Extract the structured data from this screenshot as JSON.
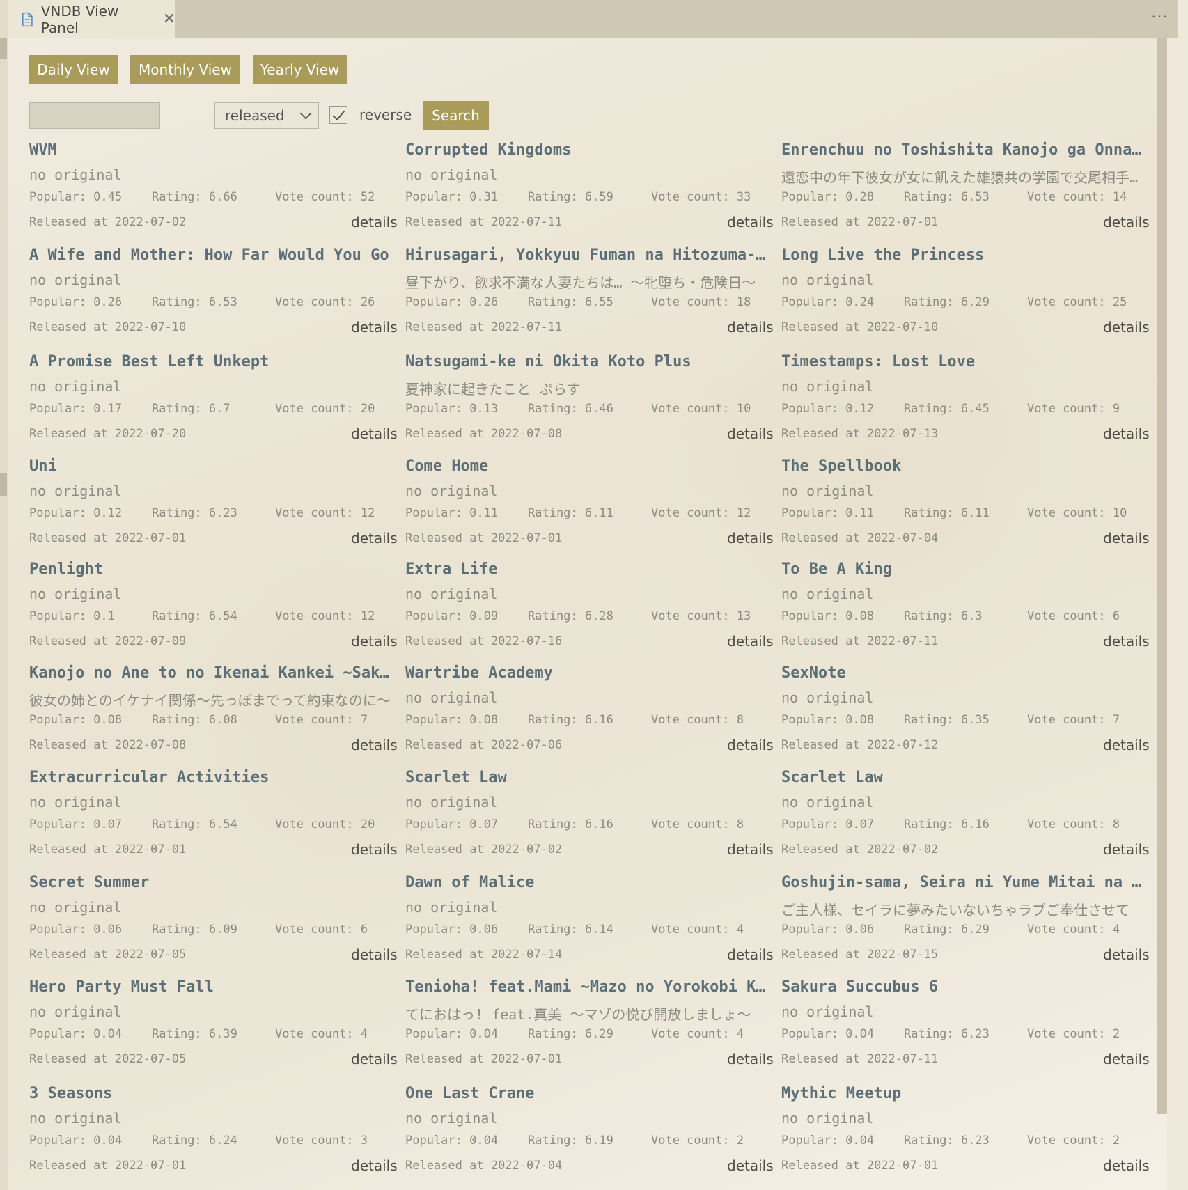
{
  "tab": {
    "title": "VNDB View Panel",
    "close": "✕",
    "more": "···"
  },
  "views": [
    "Daily View",
    "Monthly View",
    "Yearly View"
  ],
  "search": {
    "value": "",
    "placeholder": "",
    "sort": "released",
    "reverse_label": "reverse",
    "reverse_checked": true,
    "button": "Search"
  },
  "details_label": "details",
  "items": [
    {
      "title": "WVM",
      "original": "no original",
      "popular": "0.45",
      "rating": "6.66",
      "votes": "52",
      "released": "2022-07-02"
    },
    {
      "title": "Corrupted Kingdoms",
      "original": "no original",
      "popular": "0.31",
      "rating": "6.59",
      "votes": "33",
      "released": "2022-07-11"
    },
    {
      "title": "Enrenchuu no Toshishita Kanojo ga Onna ni Ueta Yuuzaru-domo no Gakuen de Koubi",
      "original": "遠恋中の年下彼女が女に飢えた雄猿共の学園で交尾相手にされる話",
      "popular": "0.28",
      "rating": "6.53",
      "votes": "14",
      "released": "2022-07-01"
    },
    {
      "title": "A Wife and Mother: How Far Would You Go",
      "original": "no original",
      "popular": "0.26",
      "rating": "6.53",
      "votes": "26",
      "released": "2022-07-10"
    },
    {
      "title": "Hirusagari, Yokkyuu Fuman na Hitozuma-tachi wa",
      "original": "昼下がり、欲求不満な人妻たちは… 〜牝堕ち・危険日〜",
      "popular": "0.26",
      "rating": "6.55",
      "votes": "18",
      "released": "2022-07-11"
    },
    {
      "title": "Long Live the Princess",
      "original": "no original",
      "popular": "0.24",
      "rating": "6.29",
      "votes": "25",
      "released": "2022-07-10"
    },
    {
      "title": "A Promise Best Left Unkept",
      "original": "no original",
      "popular": "0.17",
      "rating": "6.7",
      "votes": "20",
      "released": "2022-07-20"
    },
    {
      "title": "Natsugami-ke ni Okita Koto Plus",
      "original": "夏神家に起きたこと ぷらす",
      "popular": "0.13",
      "rating": "6.46",
      "votes": "10",
      "released": "2022-07-08"
    },
    {
      "title": "Timestamps: Lost Love",
      "original": "no original",
      "popular": "0.12",
      "rating": "6.45",
      "votes": "9",
      "released": "2022-07-13"
    },
    {
      "title": "Uni",
      "original": "no original",
      "popular": "0.12",
      "rating": "6.23",
      "votes": "12",
      "released": "2022-07-01"
    },
    {
      "title": "Come Home",
      "original": "no original",
      "popular": "0.11",
      "rating": "6.11",
      "votes": "12",
      "released": "2022-07-01"
    },
    {
      "title": "The Spellbook",
      "original": "no original",
      "popular": "0.11",
      "rating": "6.11",
      "votes": "10",
      "released": "2022-07-04"
    },
    {
      "title": "Penlight",
      "original": "no original",
      "popular": "0.1",
      "rating": "6.54",
      "votes": "12",
      "released": "2022-07-09"
    },
    {
      "title": "Extra Life",
      "original": "no original",
      "popular": "0.09",
      "rating": "6.28",
      "votes": "13",
      "released": "2022-07-16"
    },
    {
      "title": "To Be A King",
      "original": "no original",
      "popular": "0.08",
      "rating": "6.3",
      "votes": "6",
      "released": "2022-07-11"
    },
    {
      "title": "Kanojo no Ane to no Ikenai Kankei ~Sakippo made tte Yakusoku na no ni",
      "original": "彼女の姉とのイケナイ関係〜先っぽまでって約束なのに〜",
      "popular": "0.08",
      "rating": "6.08",
      "votes": "7",
      "released": "2022-07-08"
    },
    {
      "title": "Wartribe Academy",
      "original": "no original",
      "popular": "0.08",
      "rating": "6.16",
      "votes": "8",
      "released": "2022-07-06"
    },
    {
      "title": "SexNote",
      "original": "no original",
      "popular": "0.08",
      "rating": "6.35",
      "votes": "7",
      "released": "2022-07-12"
    },
    {
      "title": "Extracurricular Activities",
      "original": "no original",
      "popular": "0.07",
      "rating": "6.54",
      "votes": "20",
      "released": "2022-07-01"
    },
    {
      "title": "Scarlet Law",
      "original": "no original",
      "popular": "0.07",
      "rating": "6.16",
      "votes": "8",
      "released": "2022-07-02"
    },
    {
      "title": "Scarlet Law",
      "original": "no original",
      "popular": "0.07",
      "rating": "6.16",
      "votes": "8",
      "released": "2022-07-02"
    },
    {
      "title": "Secret Summer",
      "original": "no original",
      "popular": "0.06",
      "rating": "6.09",
      "votes": "6",
      "released": "2022-07-05"
    },
    {
      "title": "Dawn of Malice",
      "original": "no original",
      "popular": "0.06",
      "rating": "6.14",
      "votes": "4",
      "released": "2022-07-14"
    },
    {
      "title": "Goshujin-sama, Seira ni Yume Mitai na Icha Love Gohoushi sasete",
      "original": "ご主人様、セイラに夢みたいないちゃラブご奉仕させて",
      "popular": "0.06",
      "rating": "6.29",
      "votes": "4",
      "released": "2022-07-15"
    },
    {
      "title": "Hero Party Must Fall",
      "original": "no original",
      "popular": "0.04",
      "rating": "6.39",
      "votes": "4",
      "released": "2022-07-05"
    },
    {
      "title": "Tenioha! feat.Mami ~Mazo no Yorokobi Kaihou shimasho",
      "original": "てにおはっ! feat.真美 〜マゾの悦び開放しましょ〜",
      "popular": "0.04",
      "rating": "6.29",
      "votes": "4",
      "released": "2022-07-01"
    },
    {
      "title": "Sakura Succubus 6",
      "original": "no original",
      "popular": "0.04",
      "rating": "6.23",
      "votes": "2",
      "released": "2022-07-11"
    },
    {
      "title": "3 Seasons",
      "original": "no original",
      "popular": "0.04",
      "rating": "6.24",
      "votes": "3",
      "released": "2022-07-01"
    },
    {
      "title": "One Last Crane",
      "original": "no original",
      "popular": "0.04",
      "rating": "6.19",
      "votes": "2",
      "released": "2022-07-04"
    },
    {
      "title": "Mythic Meetup",
      "original": "no original",
      "popular": "0.04",
      "rating": "6.23",
      "votes": "2",
      "released": "2022-07-01"
    }
  ]
}
